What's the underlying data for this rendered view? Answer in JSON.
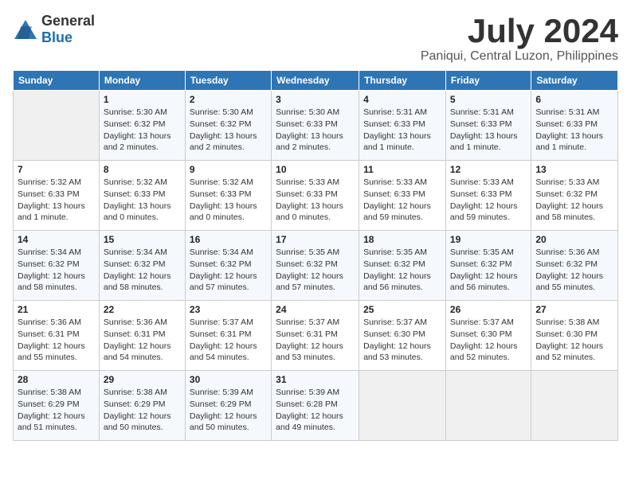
{
  "header": {
    "logo_general": "General",
    "logo_blue": "Blue",
    "month_title": "July 2024",
    "location": "Paniqui, Central Luzon, Philippines"
  },
  "weekdays": [
    "Sunday",
    "Monday",
    "Tuesday",
    "Wednesday",
    "Thursday",
    "Friday",
    "Saturday"
  ],
  "weeks": [
    [
      {
        "day": "",
        "sunrise": "",
        "sunset": "",
        "daylight": ""
      },
      {
        "day": "1",
        "sunrise": "Sunrise: 5:30 AM",
        "sunset": "Sunset: 6:32 PM",
        "daylight": "Daylight: 13 hours and 2 minutes."
      },
      {
        "day": "2",
        "sunrise": "Sunrise: 5:30 AM",
        "sunset": "Sunset: 6:32 PM",
        "daylight": "Daylight: 13 hours and 2 minutes."
      },
      {
        "day": "3",
        "sunrise": "Sunrise: 5:30 AM",
        "sunset": "Sunset: 6:33 PM",
        "daylight": "Daylight: 13 hours and 2 minutes."
      },
      {
        "day": "4",
        "sunrise": "Sunrise: 5:31 AM",
        "sunset": "Sunset: 6:33 PM",
        "daylight": "Daylight: 13 hours and 1 minute."
      },
      {
        "day": "5",
        "sunrise": "Sunrise: 5:31 AM",
        "sunset": "Sunset: 6:33 PM",
        "daylight": "Daylight: 13 hours and 1 minute."
      },
      {
        "day": "6",
        "sunrise": "Sunrise: 5:31 AM",
        "sunset": "Sunset: 6:33 PM",
        "daylight": "Daylight: 13 hours and 1 minute."
      }
    ],
    [
      {
        "day": "7",
        "sunrise": "Sunrise: 5:32 AM",
        "sunset": "Sunset: 6:33 PM",
        "daylight": "Daylight: 13 hours and 1 minute."
      },
      {
        "day": "8",
        "sunrise": "Sunrise: 5:32 AM",
        "sunset": "Sunset: 6:33 PM",
        "daylight": "Daylight: 13 hours and 0 minutes."
      },
      {
        "day": "9",
        "sunrise": "Sunrise: 5:32 AM",
        "sunset": "Sunset: 6:33 PM",
        "daylight": "Daylight: 13 hours and 0 minutes."
      },
      {
        "day": "10",
        "sunrise": "Sunrise: 5:33 AM",
        "sunset": "Sunset: 6:33 PM",
        "daylight": "Daylight: 13 hours and 0 minutes."
      },
      {
        "day": "11",
        "sunrise": "Sunrise: 5:33 AM",
        "sunset": "Sunset: 6:33 PM",
        "daylight": "Daylight: 12 hours and 59 minutes."
      },
      {
        "day": "12",
        "sunrise": "Sunrise: 5:33 AM",
        "sunset": "Sunset: 6:33 PM",
        "daylight": "Daylight: 12 hours and 59 minutes."
      },
      {
        "day": "13",
        "sunrise": "Sunrise: 5:33 AM",
        "sunset": "Sunset: 6:32 PM",
        "daylight": "Daylight: 12 hours and 58 minutes."
      }
    ],
    [
      {
        "day": "14",
        "sunrise": "Sunrise: 5:34 AM",
        "sunset": "Sunset: 6:32 PM",
        "daylight": "Daylight: 12 hours and 58 minutes."
      },
      {
        "day": "15",
        "sunrise": "Sunrise: 5:34 AM",
        "sunset": "Sunset: 6:32 PM",
        "daylight": "Daylight: 12 hours and 58 minutes."
      },
      {
        "day": "16",
        "sunrise": "Sunrise: 5:34 AM",
        "sunset": "Sunset: 6:32 PM",
        "daylight": "Daylight: 12 hours and 57 minutes."
      },
      {
        "day": "17",
        "sunrise": "Sunrise: 5:35 AM",
        "sunset": "Sunset: 6:32 PM",
        "daylight": "Daylight: 12 hours and 57 minutes."
      },
      {
        "day": "18",
        "sunrise": "Sunrise: 5:35 AM",
        "sunset": "Sunset: 6:32 PM",
        "daylight": "Daylight: 12 hours and 56 minutes."
      },
      {
        "day": "19",
        "sunrise": "Sunrise: 5:35 AM",
        "sunset": "Sunset: 6:32 PM",
        "daylight": "Daylight: 12 hours and 56 minutes."
      },
      {
        "day": "20",
        "sunrise": "Sunrise: 5:36 AM",
        "sunset": "Sunset: 6:32 PM",
        "daylight": "Daylight: 12 hours and 55 minutes."
      }
    ],
    [
      {
        "day": "21",
        "sunrise": "Sunrise: 5:36 AM",
        "sunset": "Sunset: 6:31 PM",
        "daylight": "Daylight: 12 hours and 55 minutes."
      },
      {
        "day": "22",
        "sunrise": "Sunrise: 5:36 AM",
        "sunset": "Sunset: 6:31 PM",
        "daylight": "Daylight: 12 hours and 54 minutes."
      },
      {
        "day": "23",
        "sunrise": "Sunrise: 5:37 AM",
        "sunset": "Sunset: 6:31 PM",
        "daylight": "Daylight: 12 hours and 54 minutes."
      },
      {
        "day": "24",
        "sunrise": "Sunrise: 5:37 AM",
        "sunset": "Sunset: 6:31 PM",
        "daylight": "Daylight: 12 hours and 53 minutes."
      },
      {
        "day": "25",
        "sunrise": "Sunrise: 5:37 AM",
        "sunset": "Sunset: 6:30 PM",
        "daylight": "Daylight: 12 hours and 53 minutes."
      },
      {
        "day": "26",
        "sunrise": "Sunrise: 5:37 AM",
        "sunset": "Sunset: 6:30 PM",
        "daylight": "Daylight: 12 hours and 52 minutes."
      },
      {
        "day": "27",
        "sunrise": "Sunrise: 5:38 AM",
        "sunset": "Sunset: 6:30 PM",
        "daylight": "Daylight: 12 hours and 52 minutes."
      }
    ],
    [
      {
        "day": "28",
        "sunrise": "Sunrise: 5:38 AM",
        "sunset": "Sunset: 6:29 PM",
        "daylight": "Daylight: 12 hours and 51 minutes."
      },
      {
        "day": "29",
        "sunrise": "Sunrise: 5:38 AM",
        "sunset": "Sunset: 6:29 PM",
        "daylight": "Daylight: 12 hours and 50 minutes."
      },
      {
        "day": "30",
        "sunrise": "Sunrise: 5:39 AM",
        "sunset": "Sunset: 6:29 PM",
        "daylight": "Daylight: 12 hours and 50 minutes."
      },
      {
        "day": "31",
        "sunrise": "Sunrise: 5:39 AM",
        "sunset": "Sunset: 6:28 PM",
        "daylight": "Daylight: 12 hours and 49 minutes."
      },
      {
        "day": "",
        "sunrise": "",
        "sunset": "",
        "daylight": ""
      },
      {
        "day": "",
        "sunrise": "",
        "sunset": "",
        "daylight": ""
      },
      {
        "day": "",
        "sunrise": "",
        "sunset": "",
        "daylight": ""
      }
    ]
  ]
}
